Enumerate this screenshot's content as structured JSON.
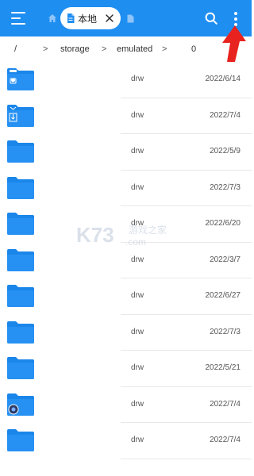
{
  "topbar": {
    "tab_label": "本地"
  },
  "breadcrumb": {
    "items": [
      "/",
      "storage",
      "emulated",
      "0"
    ],
    "sep": ">"
  },
  "files": [
    {
      "perm": "drw",
      "date": "2022/6/14",
      "badge": "camera"
    },
    {
      "perm": "drw",
      "date": "2022/7/4",
      "badge": "download"
    },
    {
      "perm": "drw",
      "date": "2022/5/9",
      "badge": ""
    },
    {
      "perm": "drw",
      "date": "2022/7/3",
      "badge": ""
    },
    {
      "perm": "drw",
      "date": "2022/6/20",
      "badge": ""
    },
    {
      "perm": "drw",
      "date": "2022/3/7",
      "badge": ""
    },
    {
      "perm": "drw",
      "date": "2022/6/27",
      "badge": ""
    },
    {
      "perm": "drw",
      "date": "2022/7/3",
      "badge": ""
    },
    {
      "perm": "drw",
      "date": "2022/5/21",
      "badge": ""
    },
    {
      "perm": "drw",
      "date": "2022/7/4",
      "badge": "app"
    },
    {
      "perm": "drw",
      "date": "2022/7/4",
      "badge": ""
    }
  ],
  "watermark": {
    "brand": "K73",
    "sub": "游戏之家",
    "domain": ".com"
  },
  "colors": {
    "accent": "#1f8ef1",
    "folder": "#1a86ea",
    "arrow": "#e8231f"
  }
}
